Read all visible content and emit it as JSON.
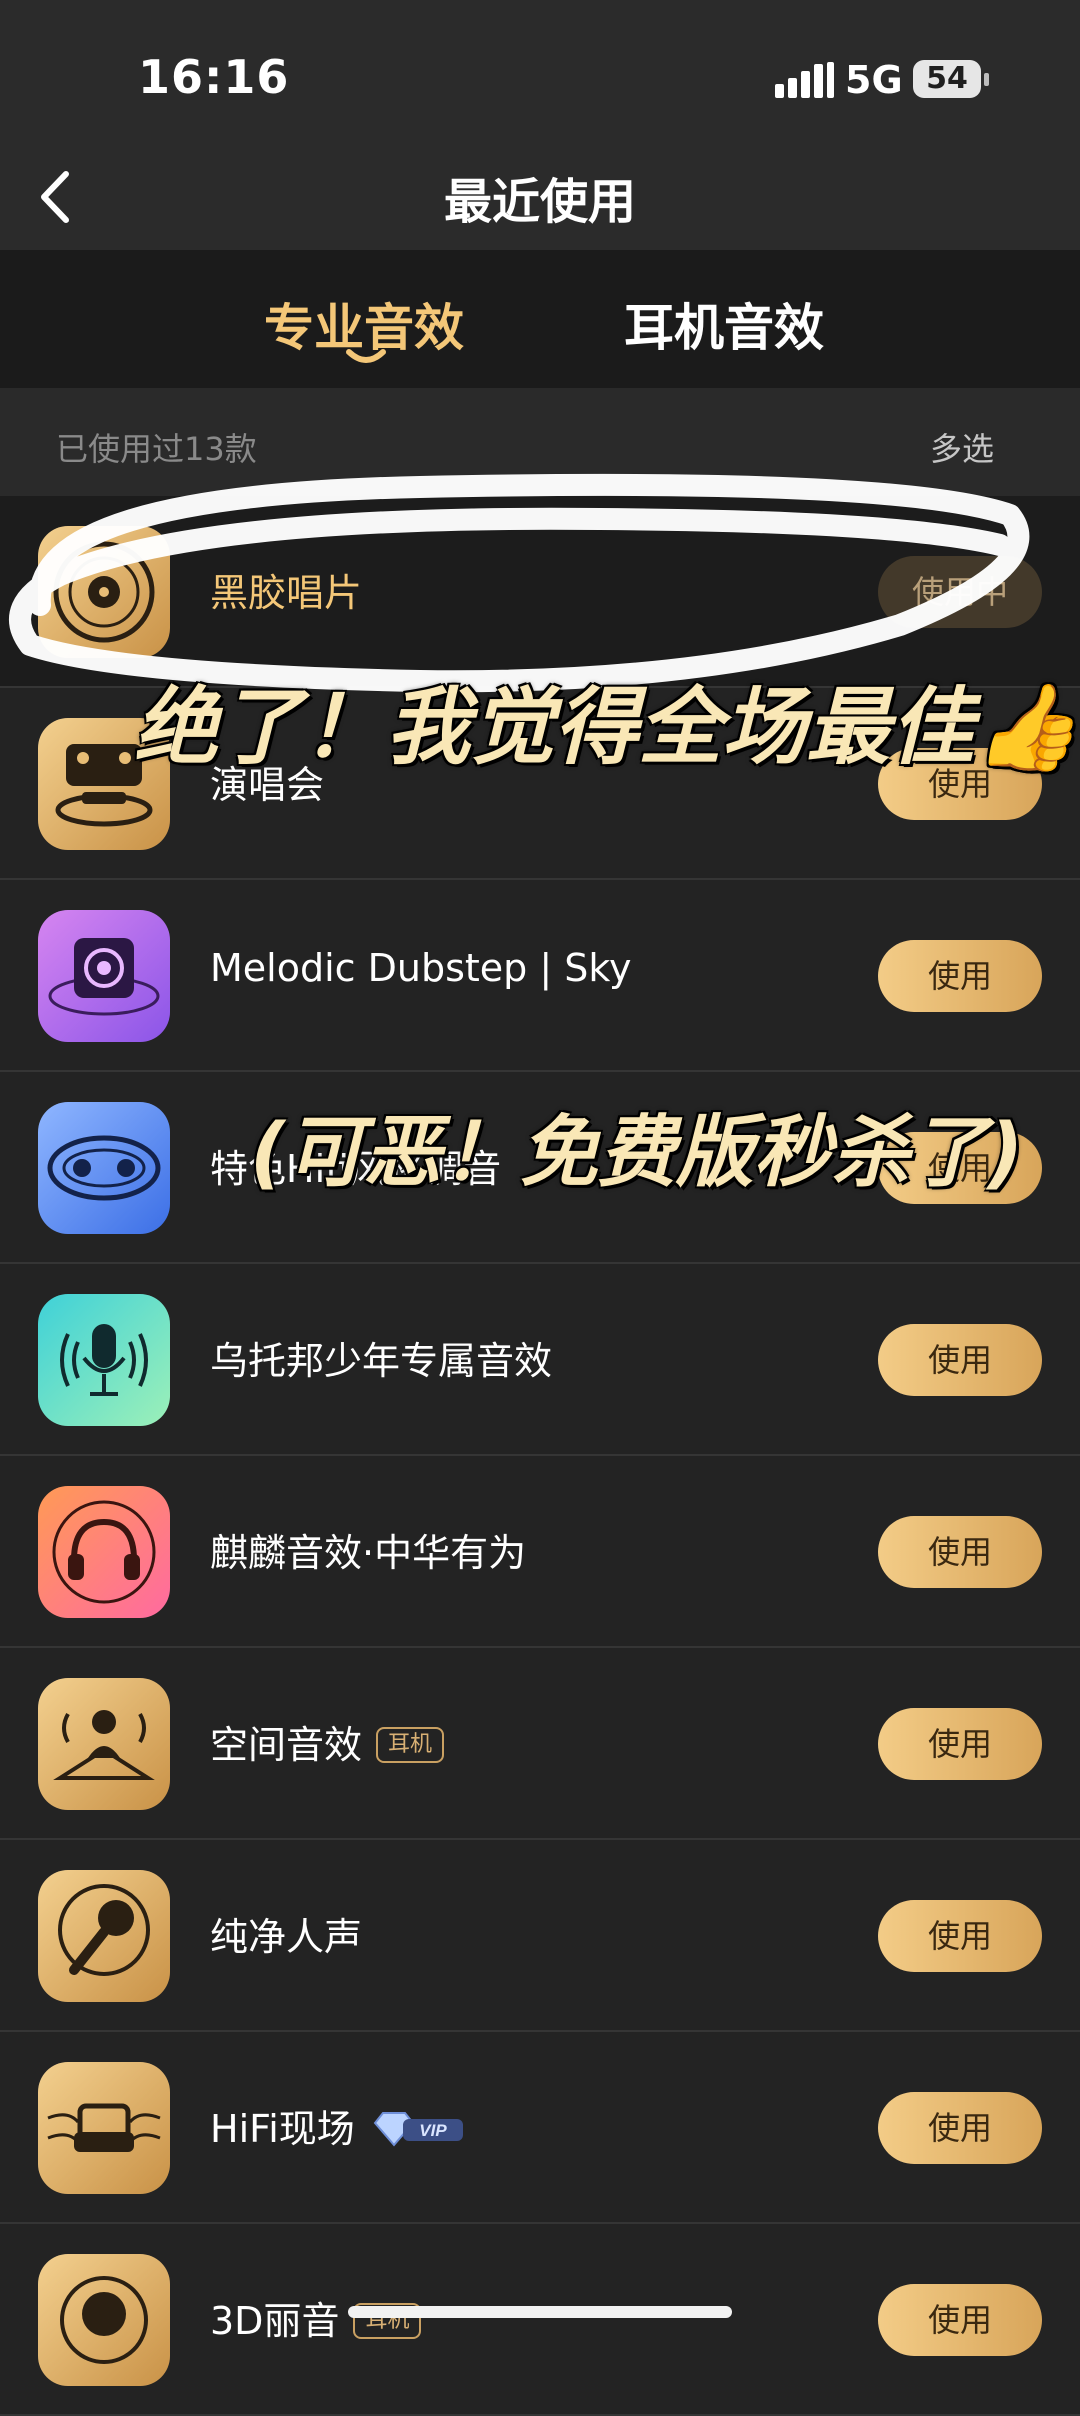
{
  "status_bar": {
    "time": "16:16",
    "network": "5G",
    "battery": "54"
  },
  "header": {
    "title": "最近使用"
  },
  "tabs": [
    {
      "label": "专业音效",
      "active": true
    },
    {
      "label": "耳机音效",
      "active": false
    }
  ],
  "summary": {
    "count_text": "已使用过13款",
    "multi_select": "多选"
  },
  "items": [
    {
      "name": "黑胶唱片",
      "button": "使用中",
      "icon": "vinyl-record-icon"
    },
    {
      "name": "演唱会",
      "button": "使用",
      "icon": "concert-stage-icon"
    },
    {
      "name": "Melodic Dubstep | Sky",
      "button": "使用",
      "icon": "speaker-icon"
    },
    {
      "name": "特色Hifi风格调音",
      "button": "使用",
      "icon": "hifi-eye-icon"
    },
    {
      "name": "乌托邦少年专属音效",
      "button": "使用",
      "icon": "microphone-icon"
    },
    {
      "name": "麒麟音效·中华有为",
      "button": "使用",
      "icon": "headphones-icon"
    },
    {
      "name": "空间音效",
      "badge": "耳机",
      "button": "使用",
      "icon": "spatial-person-icon"
    },
    {
      "name": "纯净人声",
      "button": "使用",
      "icon": "vocal-mic-icon"
    },
    {
      "name": "HiFi现场",
      "vip": "VIP",
      "button": "使用",
      "icon": "sofa-icon"
    },
    {
      "name": "3D丽音",
      "badge": "耳机",
      "button": "使用",
      "icon": "3d-head-icon"
    }
  ],
  "overlays": {
    "caption_top": "绝了！我觉得全场最佳👍",
    "caption_mid": "(可恶！免费版秒杀了)"
  },
  "colors": {
    "accent": "#f4c778",
    "background": "#232323",
    "button_gradient_start": "#f3cc87",
    "button_gradient_end": "#d8a55a"
  }
}
